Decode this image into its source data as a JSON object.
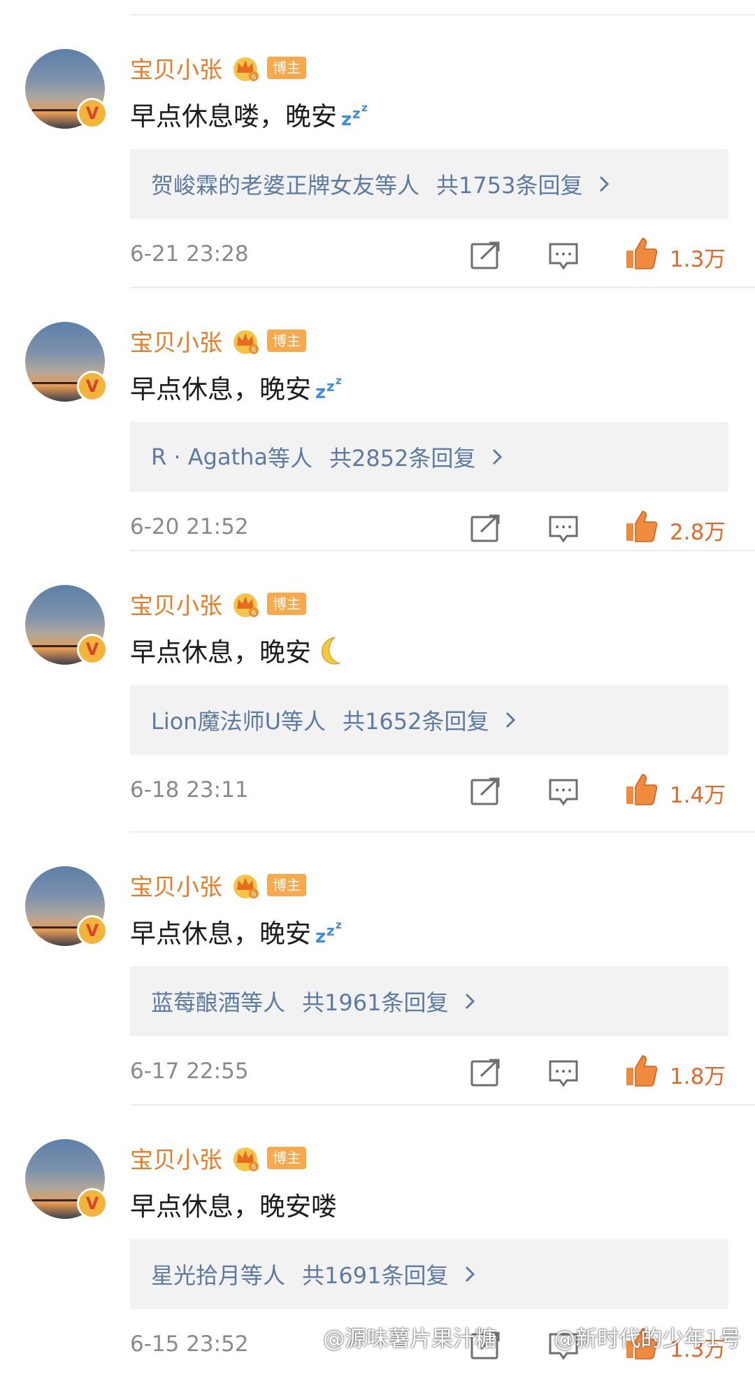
{
  "colors": {
    "username": "#eb7b23",
    "badge_bg": "#f9a84b",
    "reply_link": "#5d7aa0",
    "like": "#e06a2b",
    "timestamp": "#8a8a8a"
  },
  "comments": [
    {
      "username": "宝贝小张",
      "badge": "博主",
      "text": "早点休息喽，晚安",
      "emoji": "zzz-icon",
      "reply_users": "贺峻霖的老婆正牌女友",
      "reply_suffix": "等人",
      "reply_count": "共1753条回复",
      "timestamp": "6-21 23:28",
      "likes": "1.3万"
    },
    {
      "username": "宝贝小张",
      "badge": "博主",
      "text": "早点休息，晚安",
      "emoji": "zzz-icon",
      "reply_users": "R · Agatha",
      "reply_suffix": "等人",
      "reply_count": "共2852条回复",
      "timestamp": "6-20 21:52",
      "likes": "2.8万"
    },
    {
      "username": "宝贝小张",
      "badge": "博主",
      "text": "早点休息，晚安",
      "emoji": "moon-icon",
      "reply_users": "Lion魔法师U",
      "reply_suffix": "等人",
      "reply_count": "共1652条回复",
      "timestamp": "6-18 23:11",
      "likes": "1.4万"
    },
    {
      "username": "宝贝小张",
      "badge": "博主",
      "text": "早点休息，晚安",
      "emoji": "zzz-icon",
      "reply_users": "蓝莓酿酒",
      "reply_suffix": "等人",
      "reply_count": "共1961条回复",
      "timestamp": "6-17 22:55",
      "likes": "1.8万"
    },
    {
      "username": "宝贝小张",
      "badge": "博主",
      "text": "早点休息，晚安喽",
      "emoji": "",
      "reply_users": "星光拾月",
      "reply_suffix": "等人",
      "reply_count": "共1691条回复",
      "timestamp": "6-15 23:52",
      "likes": "1.3万"
    }
  ],
  "watermarks": [
    "@源味薯片果汁糖",
    "@新时代的少年1号"
  ]
}
